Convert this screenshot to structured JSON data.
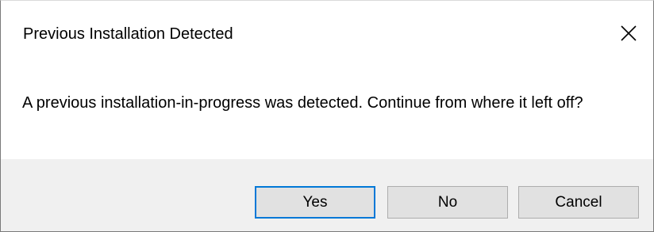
{
  "dialog": {
    "title": "Previous Installation Detected",
    "message": "A previous installation-in-progress was detected. Continue from where it left off?",
    "close_icon": "close-icon",
    "buttons": {
      "yes_label": "Yes",
      "no_label": "No",
      "cancel_label": "Cancel"
    },
    "colors": {
      "footer_background": "#f0f0f0",
      "button_background": "#e1e1e1",
      "button_border": "#adadad",
      "default_button_border": "#0078d7"
    }
  }
}
